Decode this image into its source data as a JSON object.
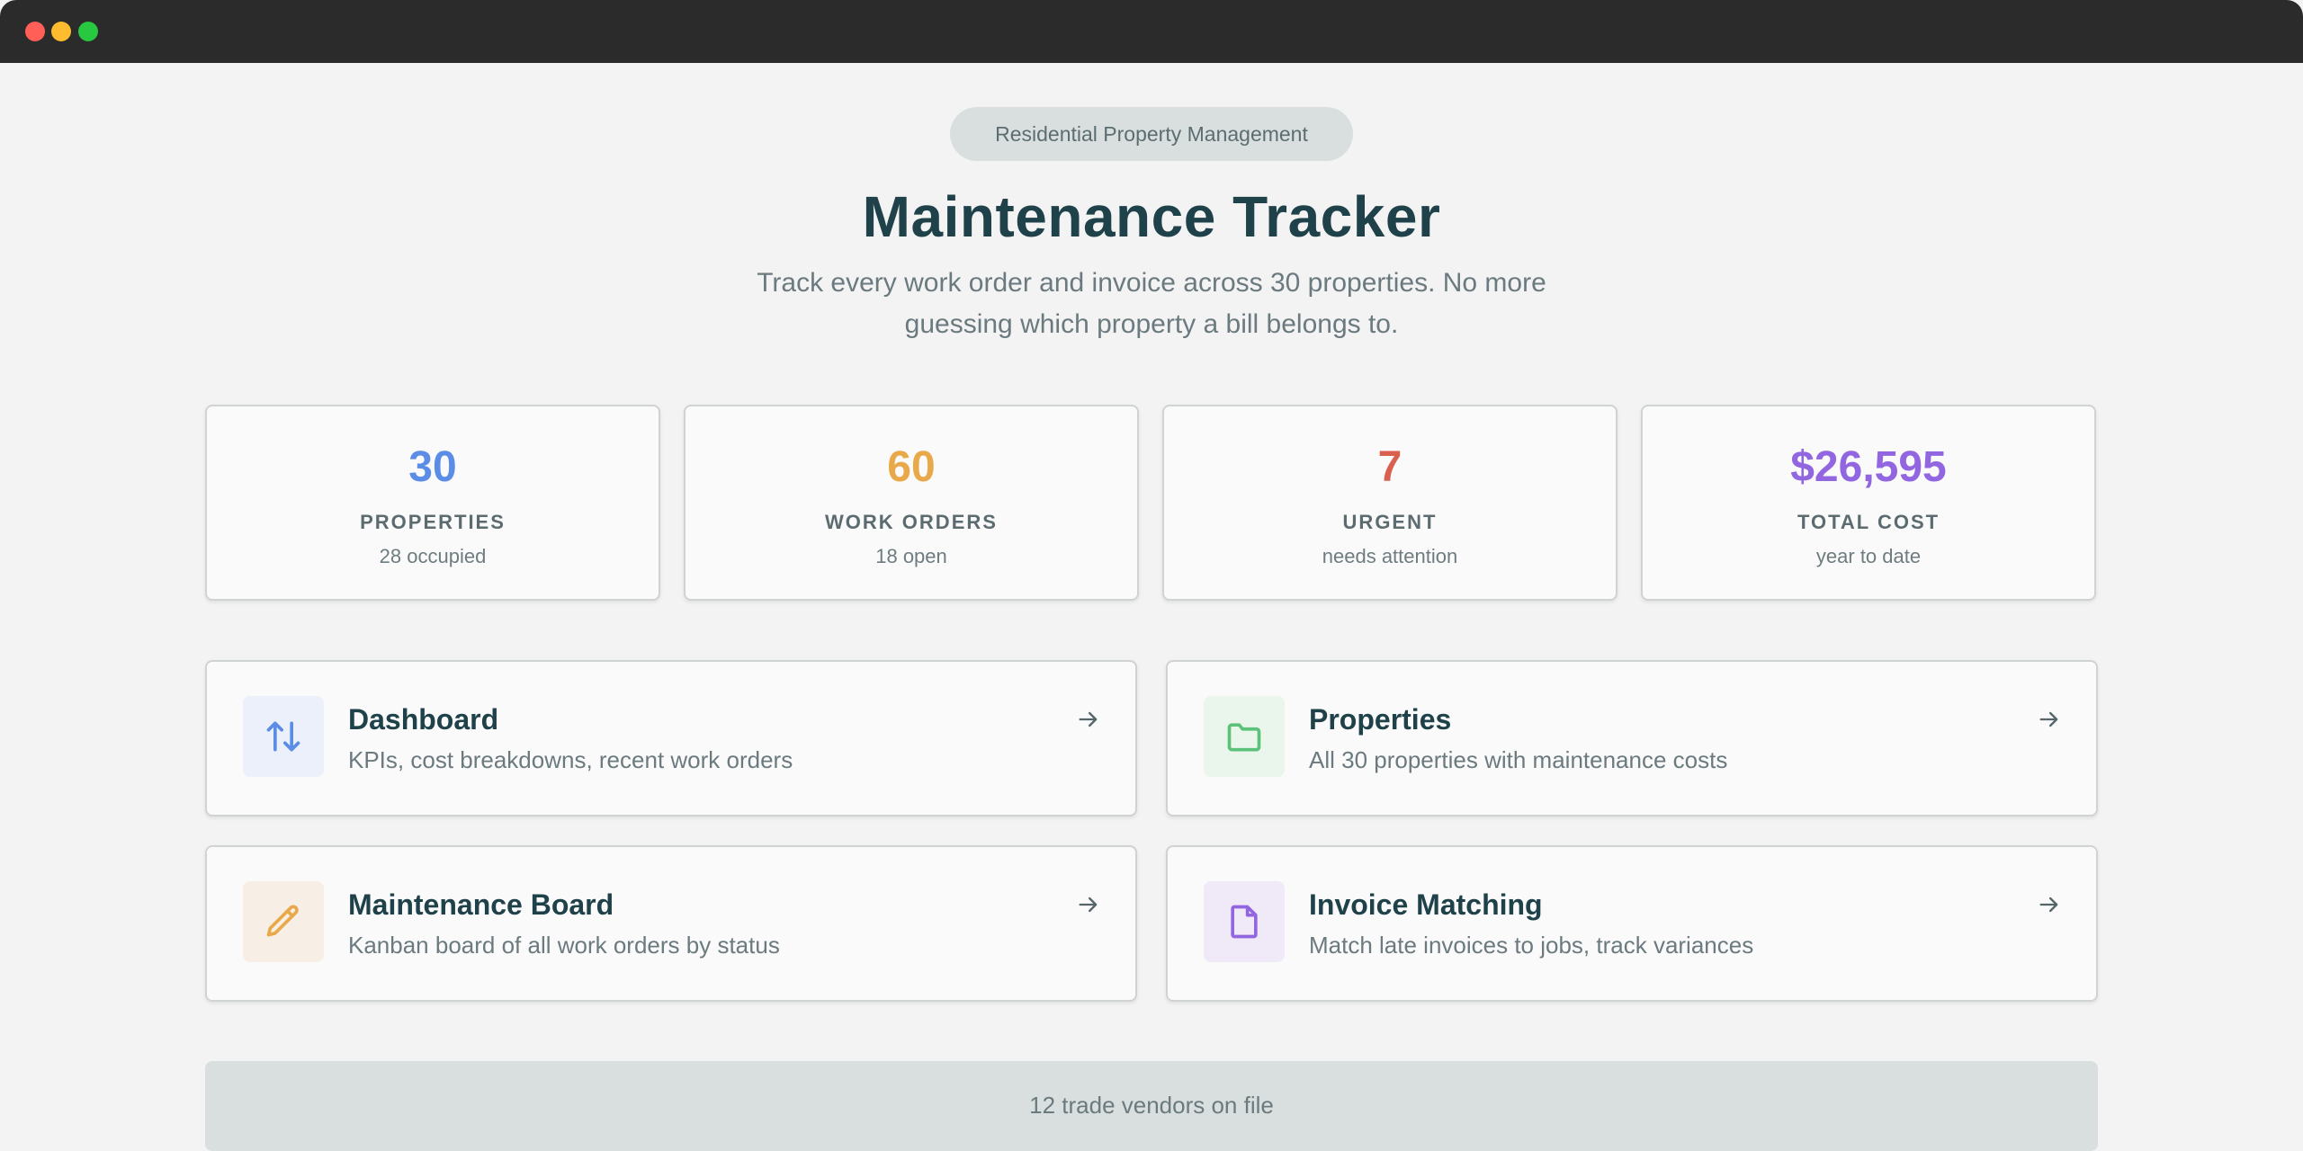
{
  "window": {
    "controls": [
      "close",
      "minimize",
      "maximize"
    ]
  },
  "header": {
    "badge": "Residential Property Management",
    "title": "Maintenance Tracker",
    "subtitle": "Track every work order and invoice across 30 properties. No more guessing which property a bill belongs to."
  },
  "stats": [
    {
      "value": "30",
      "label": "PROPERTIES",
      "sub": "28 occupied",
      "color": "#5b8de6"
    },
    {
      "value": "60",
      "label": "WORK ORDERS",
      "sub": "18 open",
      "color": "#e9a84a"
    },
    {
      "value": "7",
      "label": "URGENT",
      "sub": "needs attention",
      "color": "#d95f4f"
    },
    {
      "value": "$26,595",
      "label": "TOTAL COST",
      "sub": "year to date",
      "color": "#9166e0"
    }
  ],
  "cards": [
    {
      "title": "Dashboard",
      "desc": "KPIs, cost breakdowns, recent work orders",
      "icon": "arrows-up-down-icon",
      "color": "#5b8de6",
      "bg": "#ebf0fa"
    },
    {
      "title": "Properties",
      "desc": "All 30 properties with maintenance costs",
      "icon": "folder-icon",
      "color": "#5cc27a",
      "bg": "#eaf5ec"
    },
    {
      "title": "Maintenance Board",
      "desc": "Kanban board of all work orders by status",
      "icon": "pencil-icon",
      "color": "#e9a84a",
      "bg": "#f7efe5"
    },
    {
      "title": "Invoice Matching",
      "desc": "Match late invoices to jobs, track variances",
      "icon": "document-icon",
      "color": "#9166e0",
      "bg": "#f0eaf8"
    }
  ],
  "footer": {
    "text": "12 trade vendors on file"
  }
}
